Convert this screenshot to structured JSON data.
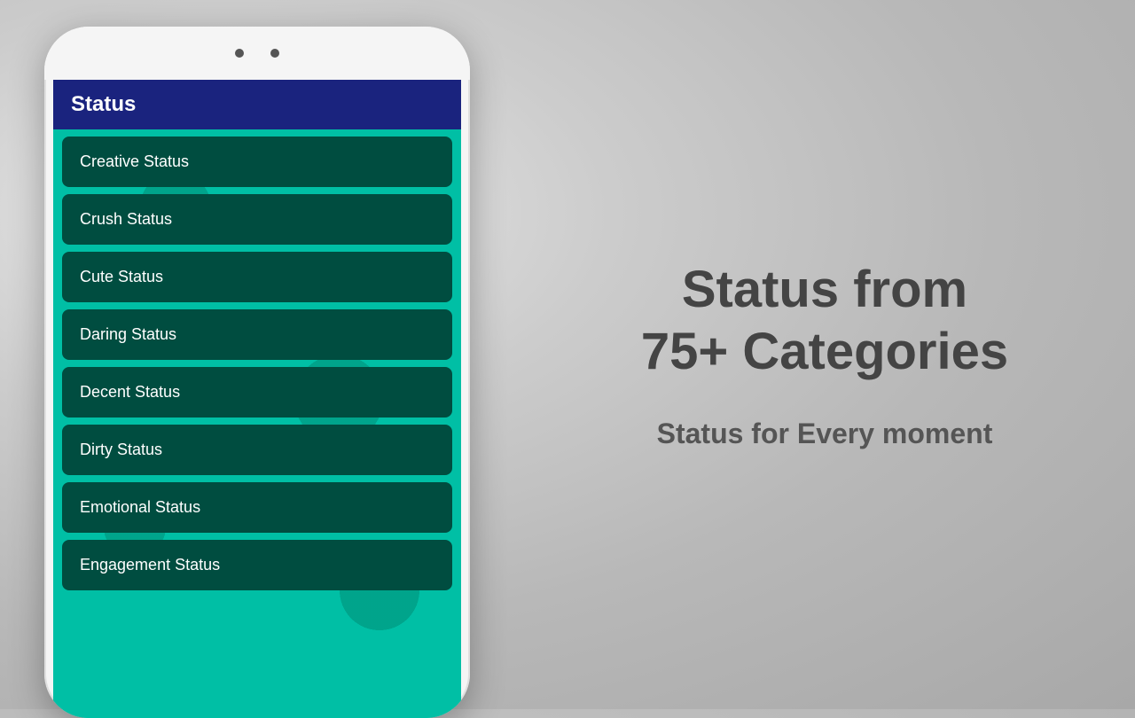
{
  "background": {
    "color": "#c8c8c8"
  },
  "phone": {
    "header": {
      "title": "Status"
    },
    "menu_items": [
      {
        "label": "Creative Status"
      },
      {
        "label": "Crush Status"
      },
      {
        "label": "Cute Status"
      },
      {
        "label": "Daring Status"
      },
      {
        "label": "Decent Status"
      },
      {
        "label": "Dirty Status"
      },
      {
        "label": "Emotional Status"
      },
      {
        "label": "Engagement Status"
      }
    ]
  },
  "right": {
    "headline": "Status from\n75+ Categories",
    "subheadline": "Status for Every moment"
  }
}
